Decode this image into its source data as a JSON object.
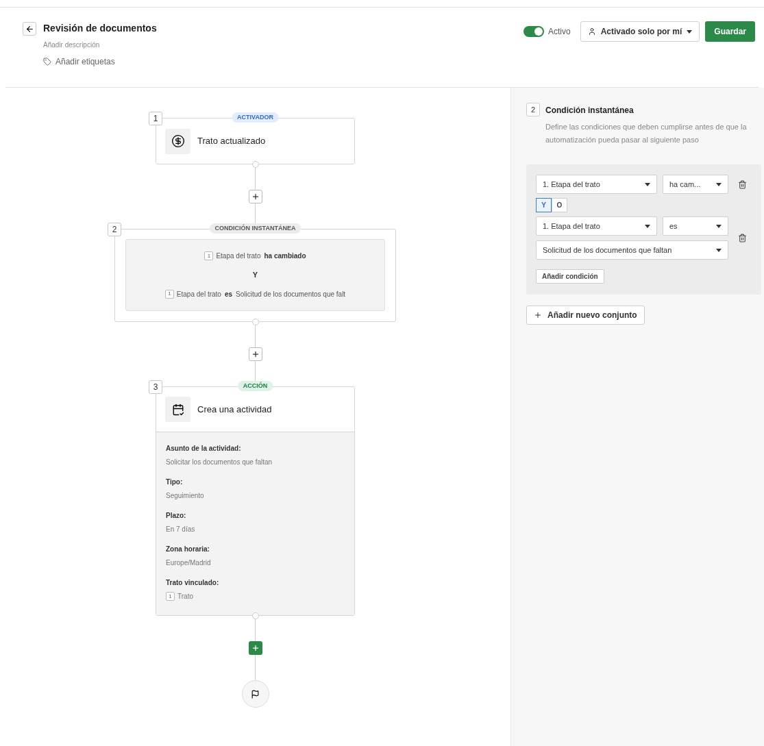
{
  "header": {
    "title": "Revisión de documentos",
    "description": "Añadir descripción",
    "tags_label": "Añadir etiquetas",
    "active_toggle": {
      "label": "Activo",
      "on": true
    },
    "visibility_dropdown": {
      "label": "Activado solo por mí"
    },
    "save_button": "Guardar"
  },
  "flow": {
    "steps": [
      {
        "kind": "trigger",
        "number": "1",
        "badge": "ACTIVADOR",
        "title": "Trato actualizado"
      },
      {
        "kind": "condition",
        "number": "2",
        "badge": "CONDICIÓN INSTANTÁNEA",
        "joiner": "Y",
        "conditions": [
          {
            "ref": "1",
            "field": "Etapa del trato",
            "operator": "ha cambiado"
          },
          {
            "ref": "1",
            "field": "Etapa del trato",
            "operator": "es",
            "value": "Solicitud de los documentos que falt"
          }
        ]
      },
      {
        "kind": "action",
        "number": "3",
        "badge": "ACCIÓN",
        "title": "Crea una actividad",
        "details": [
          {
            "label": "Asunto de la actividad:",
            "value": "Solicitar los documentos que faltan"
          },
          {
            "label": "Tipo:",
            "value": "Seguimiento"
          },
          {
            "label": "Plazo:",
            "value": "En 7 días"
          },
          {
            "label": "Zona horaria:",
            "value": "Europe/Madrid"
          },
          {
            "label": "Trato vinculado:",
            "ref": "1",
            "value": "Trato"
          }
        ]
      }
    ]
  },
  "panel": {
    "number": "2",
    "title": "Condición instantánea",
    "description": "Define las condiciones que deben cumplirse antes de que la automatización pueda pasar al siguiente paso",
    "rows": [
      {
        "field": "1. Etapa del trato",
        "operator": "ha cam..."
      },
      {
        "field": "1. Etapa del trato",
        "operator": "es",
        "value": "Solicitud de los documentos que faltan"
      }
    ],
    "logic": [
      {
        "label": "Y",
        "selected": true
      },
      {
        "label": "O",
        "selected": false
      }
    ],
    "add_condition": "Añadir condición",
    "add_set": "Añadir nuevo conjunto"
  }
}
